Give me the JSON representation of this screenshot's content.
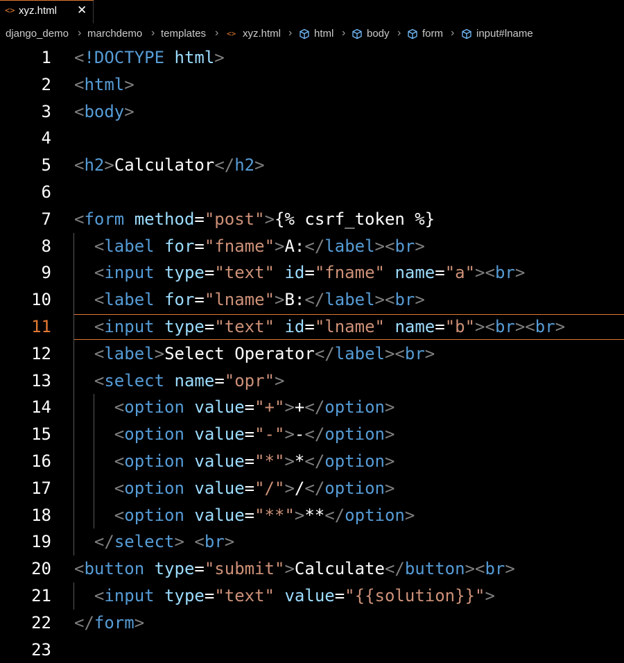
{
  "tab": {
    "icon": "<>",
    "name": "xyz.html",
    "close": "✕"
  },
  "breadcrumbs": [
    "django_demo",
    "marchdemo",
    "templates",
    "xyz.html",
    "html",
    "body",
    "form",
    "input#lname"
  ],
  "breadcrumb_separator": "›",
  "accent_color": "#e37933",
  "active_line": 11,
  "lines": [
    {
      "n": "1",
      "indent": "",
      "tokens": [
        [
          "t",
          "<"
        ],
        [
          "tn",
          "!DOCTYPE"
        ],
        [
          "tx",
          " "
        ],
        [
          "an",
          "html"
        ],
        [
          "t",
          ">"
        ]
      ]
    },
    {
      "n": "2",
      "indent": "",
      "tokens": [
        [
          "t",
          "<"
        ],
        [
          "tn",
          "html"
        ],
        [
          "t",
          ">"
        ]
      ]
    },
    {
      "n": "3",
      "indent": "",
      "tokens": [
        [
          "t",
          "<"
        ],
        [
          "tn",
          "body"
        ],
        [
          "t",
          ">"
        ]
      ]
    },
    {
      "n": "4",
      "indent": "",
      "tokens": []
    },
    {
      "n": "5",
      "indent": "",
      "tokens": [
        [
          "t",
          "<"
        ],
        [
          "tn",
          "h2"
        ],
        [
          "t",
          ">"
        ],
        [
          "tx",
          "Calculator"
        ],
        [
          "t",
          "</"
        ],
        [
          "tn",
          "h2"
        ],
        [
          "t",
          ">"
        ]
      ]
    },
    {
      "n": "6",
      "indent": "",
      "tokens": []
    },
    {
      "n": "7",
      "indent": "",
      "tokens": [
        [
          "t",
          "<"
        ],
        [
          "tn",
          "form"
        ],
        [
          "tx",
          " "
        ],
        [
          "an",
          "method"
        ],
        [
          "tx",
          "="
        ],
        [
          "av",
          "\"post\""
        ],
        [
          "t",
          ">"
        ],
        [
          "tx",
          "{% csrf_token %}"
        ]
      ]
    },
    {
      "n": "8",
      "indent": "  ",
      "tokens": [
        [
          "t",
          "<"
        ],
        [
          "tn",
          "label"
        ],
        [
          "tx",
          " "
        ],
        [
          "an",
          "for"
        ],
        [
          "tx",
          "="
        ],
        [
          "av",
          "\"fname\""
        ],
        [
          "t",
          ">"
        ],
        [
          "tx",
          "A:"
        ],
        [
          "t",
          "</"
        ],
        [
          "tn",
          "label"
        ],
        [
          "t",
          "><"
        ],
        [
          "tn",
          "br"
        ],
        [
          "t",
          ">"
        ]
      ]
    },
    {
      "n": "9",
      "indent": "  ",
      "tokens": [
        [
          "t",
          "<"
        ],
        [
          "tn",
          "input"
        ],
        [
          "tx",
          " "
        ],
        [
          "an",
          "type"
        ],
        [
          "tx",
          "="
        ],
        [
          "av",
          "\"text\""
        ],
        [
          "tx",
          " "
        ],
        [
          "an",
          "id"
        ],
        [
          "tx",
          "="
        ],
        [
          "av",
          "\"fname\""
        ],
        [
          "tx",
          " "
        ],
        [
          "an",
          "name"
        ],
        [
          "tx",
          "="
        ],
        [
          "av",
          "\"a\""
        ],
        [
          "t",
          "><"
        ],
        [
          "tn",
          "br"
        ],
        [
          "t",
          ">"
        ]
      ]
    },
    {
      "n": "10",
      "indent": "  ",
      "tokens": [
        [
          "t",
          "<"
        ],
        [
          "tn",
          "label"
        ],
        [
          "tx",
          " "
        ],
        [
          "an",
          "for"
        ],
        [
          "tx",
          "="
        ],
        [
          "av",
          "\"lname\""
        ],
        [
          "t",
          ">"
        ],
        [
          "tx",
          "B:"
        ],
        [
          "t",
          "</"
        ],
        [
          "tn",
          "label"
        ],
        [
          "t",
          "><"
        ],
        [
          "tn",
          "br"
        ],
        [
          "t",
          ">"
        ]
      ]
    },
    {
      "n": "11",
      "indent": "  ",
      "tokens": [
        [
          "t",
          "<"
        ],
        [
          "tn",
          "input"
        ],
        [
          "tx",
          " "
        ],
        [
          "an",
          "type"
        ],
        [
          "tx",
          "="
        ],
        [
          "av",
          "\"text\""
        ],
        [
          "tx",
          " "
        ],
        [
          "an",
          "id"
        ],
        [
          "tx",
          "="
        ],
        [
          "av",
          "\"lname\""
        ],
        [
          "tx",
          " "
        ],
        [
          "an",
          "name"
        ],
        [
          "tx",
          "="
        ],
        [
          "av",
          "\"b\""
        ],
        [
          "t",
          "><"
        ],
        [
          "tn",
          "br"
        ],
        [
          "t",
          "><"
        ],
        [
          "tn",
          "br"
        ],
        [
          "t",
          ">"
        ]
      ]
    },
    {
      "n": "12",
      "indent": "  ",
      "tokens": [
        [
          "t",
          "<"
        ],
        [
          "tn",
          "label"
        ],
        [
          "t",
          ">"
        ],
        [
          "tx",
          "Select Operator"
        ],
        [
          "t",
          "</"
        ],
        [
          "tn",
          "label"
        ],
        [
          "t",
          "><"
        ],
        [
          "tn",
          "br"
        ],
        [
          "t",
          ">"
        ]
      ]
    },
    {
      "n": "13",
      "indent": "  ",
      "tokens": [
        [
          "t",
          "<"
        ],
        [
          "tn",
          "select"
        ],
        [
          "tx",
          " "
        ],
        [
          "an",
          "name"
        ],
        [
          "tx",
          "="
        ],
        [
          "av",
          "\"opr\""
        ],
        [
          "t",
          ">"
        ]
      ]
    },
    {
      "n": "14",
      "indent": "    ",
      "tokens": [
        [
          "t",
          "<"
        ],
        [
          "tn",
          "option"
        ],
        [
          "tx",
          " "
        ],
        [
          "an",
          "value"
        ],
        [
          "tx",
          "="
        ],
        [
          "av",
          "\"+\""
        ],
        [
          "t",
          ">"
        ],
        [
          "tx",
          "+"
        ],
        [
          "t",
          "</"
        ],
        [
          "tn",
          "option"
        ],
        [
          "t",
          ">"
        ]
      ]
    },
    {
      "n": "15",
      "indent": "    ",
      "tokens": [
        [
          "t",
          "<"
        ],
        [
          "tn",
          "option"
        ],
        [
          "tx",
          " "
        ],
        [
          "an",
          "value"
        ],
        [
          "tx",
          "="
        ],
        [
          "av",
          "\"-\""
        ],
        [
          "t",
          ">"
        ],
        [
          "tx",
          "-"
        ],
        [
          "t",
          "</"
        ],
        [
          "tn",
          "option"
        ],
        [
          "t",
          ">"
        ]
      ]
    },
    {
      "n": "16",
      "indent": "    ",
      "tokens": [
        [
          "t",
          "<"
        ],
        [
          "tn",
          "option"
        ],
        [
          "tx",
          " "
        ],
        [
          "an",
          "value"
        ],
        [
          "tx",
          "="
        ],
        [
          "av",
          "\"*\""
        ],
        [
          "t",
          ">"
        ],
        [
          "tx",
          "*"
        ],
        [
          "t",
          "</"
        ],
        [
          "tn",
          "option"
        ],
        [
          "t",
          ">"
        ]
      ]
    },
    {
      "n": "17",
      "indent": "    ",
      "tokens": [
        [
          "t",
          "<"
        ],
        [
          "tn",
          "option"
        ],
        [
          "tx",
          " "
        ],
        [
          "an",
          "value"
        ],
        [
          "tx",
          "="
        ],
        [
          "av",
          "\"/\""
        ],
        [
          "t",
          ">"
        ],
        [
          "tx",
          "/"
        ],
        [
          "t",
          "</"
        ],
        [
          "tn",
          "option"
        ],
        [
          "t",
          ">"
        ]
      ]
    },
    {
      "n": "18",
      "indent": "    ",
      "tokens": [
        [
          "t",
          "<"
        ],
        [
          "tn",
          "option"
        ],
        [
          "tx",
          " "
        ],
        [
          "an",
          "value"
        ],
        [
          "tx",
          "="
        ],
        [
          "av",
          "\"**\""
        ],
        [
          "t",
          ">"
        ],
        [
          "tx",
          "**"
        ],
        [
          "t",
          "</"
        ],
        [
          "tn",
          "option"
        ],
        [
          "t",
          ">"
        ]
      ]
    },
    {
      "n": "19",
      "indent": "  ",
      "tokens": [
        [
          "t",
          "</"
        ],
        [
          "tn",
          "select"
        ],
        [
          "t",
          ">"
        ],
        [
          "tx",
          " "
        ],
        [
          "t",
          "<"
        ],
        [
          "tn",
          "br"
        ],
        [
          "t",
          ">"
        ]
      ]
    },
    {
      "n": "20",
      "indent": "",
      "tokens": [
        [
          "t",
          "<"
        ],
        [
          "tn",
          "button"
        ],
        [
          "tx",
          " "
        ],
        [
          "an",
          "type"
        ],
        [
          "tx",
          "="
        ],
        [
          "av",
          "\"submit\""
        ],
        [
          "t",
          ">"
        ],
        [
          "tx",
          "Calculate"
        ],
        [
          "t",
          "</"
        ],
        [
          "tn",
          "button"
        ],
        [
          "t",
          "><"
        ],
        [
          "tn",
          "br"
        ],
        [
          "t",
          ">"
        ]
      ]
    },
    {
      "n": "21",
      "indent": "  ",
      "tokens": [
        [
          "t",
          "<"
        ],
        [
          "tn",
          "input"
        ],
        [
          "tx",
          " "
        ],
        [
          "an",
          "type"
        ],
        [
          "tx",
          "="
        ],
        [
          "av",
          "\"text\""
        ],
        [
          "tx",
          " "
        ],
        [
          "an",
          "value"
        ],
        [
          "tx",
          "="
        ],
        [
          "av",
          "\"{{solution}}\""
        ],
        [
          "t",
          ">"
        ]
      ]
    },
    {
      "n": "22",
      "indent": "",
      "tokens": [
        [
          "t",
          "</"
        ],
        [
          "tn",
          "form"
        ],
        [
          "t",
          ">"
        ]
      ]
    },
    {
      "n": "23",
      "indent": "",
      "tokens": []
    }
  ]
}
